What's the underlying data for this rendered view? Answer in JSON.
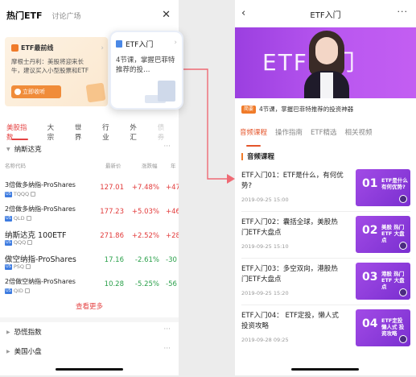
{
  "left": {
    "header": {
      "title": "热门ETF",
      "tab2": "讨论广场"
    },
    "banner": {
      "tag": "ETF最前线",
      "text": "摩根士丹利：美股将迎来长牛，建议买入小型股票和ETF",
      "button": "立即收听"
    },
    "popcard": {
      "title": "ETF入门",
      "text": "4节课，掌握巴菲特推荐的投…"
    },
    "market_tabs": [
      "美股指数",
      "大宗",
      "世界",
      "行业",
      "外汇",
      "债券"
    ],
    "section_nasdaq": "纳斯达克",
    "columns": {
      "name": "名称代码",
      "price": "最新价",
      "change": "涨跌幅",
      "amount": "年"
    },
    "rows": [
      {
        "name": "3倍做多纳指-ProShares",
        "code": "TQQQ",
        "price": "127.01",
        "pct": "+7.48%",
        "amt": "+47"
      },
      {
        "name": "2倍做多纳指-ProShares",
        "code": "QLD",
        "price": "177.23",
        "pct": "+5.03%",
        "amt": "+46"
      },
      {
        "name": "纳斯达克 100ETF",
        "code": "QQQ",
        "price": "271.86",
        "pct": "+2.52%",
        "amt": "+28"
      },
      {
        "name": "做空纳指-ProShares",
        "code": "PSQ",
        "price": "17.16",
        "pct": "-2.61%",
        "amt": "-30"
      },
      {
        "name": "2倍做空纳指-ProShares",
        "code": "QID",
        "price": "10.28",
        "pct": "-5.25%",
        "amt": "-56"
      }
    ],
    "show_more": "查看更多",
    "section_fear": "恐慌指数",
    "section_smallcap": "美国小盘",
    "more_dots": "···"
  },
  "right": {
    "header": {
      "title": "ETF入门",
      "more": "···"
    },
    "hero_text": "ETF入门",
    "desc_tag": "简要",
    "desc": "4节课，掌握巴菲特推荐的投资神器",
    "tabs": [
      "音频课程",
      "操作指南",
      "ETF精选",
      "相关视频"
    ],
    "section": "音频课程",
    "lessons": [
      {
        "title": "ETF入门01：ETF是什么，有何优势?",
        "date": "2019-09-25 15:00",
        "num": "01",
        "cap": "ETF是什么 有何优势?"
      },
      {
        "title": "ETF入门02：囊括全球，美股热门ETF大盘点",
        "date": "2019-09-25 15:10",
        "num": "02",
        "cap": "美股 热门ETF 大盘点"
      },
      {
        "title": "ETF入门03：多空双向，港股热门ETF大盘点",
        "date": "2019-09-25 15:20",
        "num": "03",
        "cap": "港股 热门ETF 大盘点"
      },
      {
        "title": "ETF入门04： ETF定投，懒人式投资攻略",
        "date": "2019-09-28 09:25",
        "num": "04",
        "cap": "ETF定投 懒人式 投资攻略"
      }
    ]
  },
  "colors": {
    "up": "#e23a3a",
    "down": "#2aa04a",
    "accent": "#e44444",
    "purple": "#a24be6",
    "arrow": "#ef6a74"
  }
}
